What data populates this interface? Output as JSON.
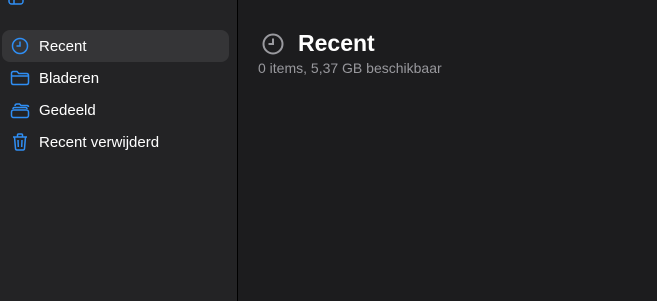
{
  "sidebar": {
    "items": [
      {
        "label": "Recent",
        "icon": "clock-icon",
        "selected": true
      },
      {
        "label": "Bladeren",
        "icon": "folder-icon",
        "selected": false
      },
      {
        "label": "Gedeeld",
        "icon": "shared-folder-icon",
        "selected": false
      },
      {
        "label": "Recent verwijderd",
        "icon": "trash-icon",
        "selected": false
      }
    ]
  },
  "main": {
    "title": "Recent",
    "subtitle": "0 items, 5,37 GB beschikbaar"
  },
  "colors": {
    "accent": "#2f8ef4",
    "sidebar_bg": "#232325",
    "main_bg": "#1c1c1e",
    "selected_bg": "#353537",
    "secondary_text": "#98989d"
  }
}
